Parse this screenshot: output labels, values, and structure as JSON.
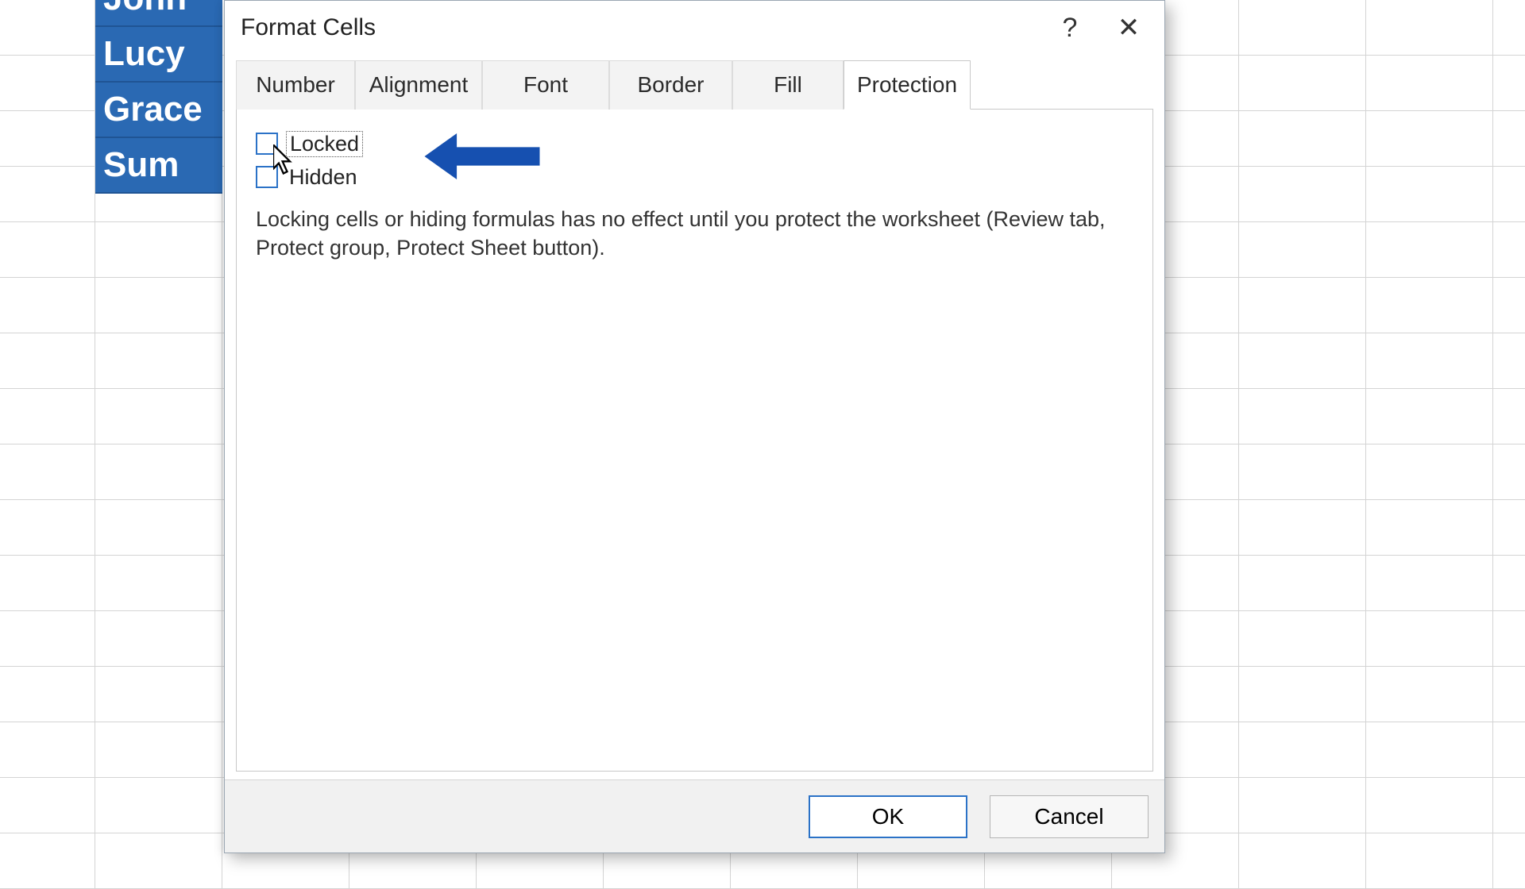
{
  "sheet": {
    "names": [
      "John",
      "Lucy",
      "Grace",
      "Sum"
    ]
  },
  "dialog": {
    "title": "Format Cells",
    "help_glyph": "?",
    "close_glyph": "✕",
    "tabs": {
      "number": "Number",
      "alignment": "Alignment",
      "font": "Font",
      "border": "Border",
      "fill": "Fill",
      "protection": "Protection"
    },
    "active_tab": "protection",
    "protection": {
      "locked_label": "Locked",
      "hidden_label": "Hidden",
      "locked_checked": false,
      "hidden_checked": false,
      "info": "Locking cells or hiding formulas has no effect until you protect the worksheet (Review tab, Protect group, Protect Sheet button)."
    },
    "buttons": {
      "ok": "OK",
      "cancel": "Cancel"
    }
  },
  "annotation": {
    "arrow_color": "#1650b0"
  }
}
